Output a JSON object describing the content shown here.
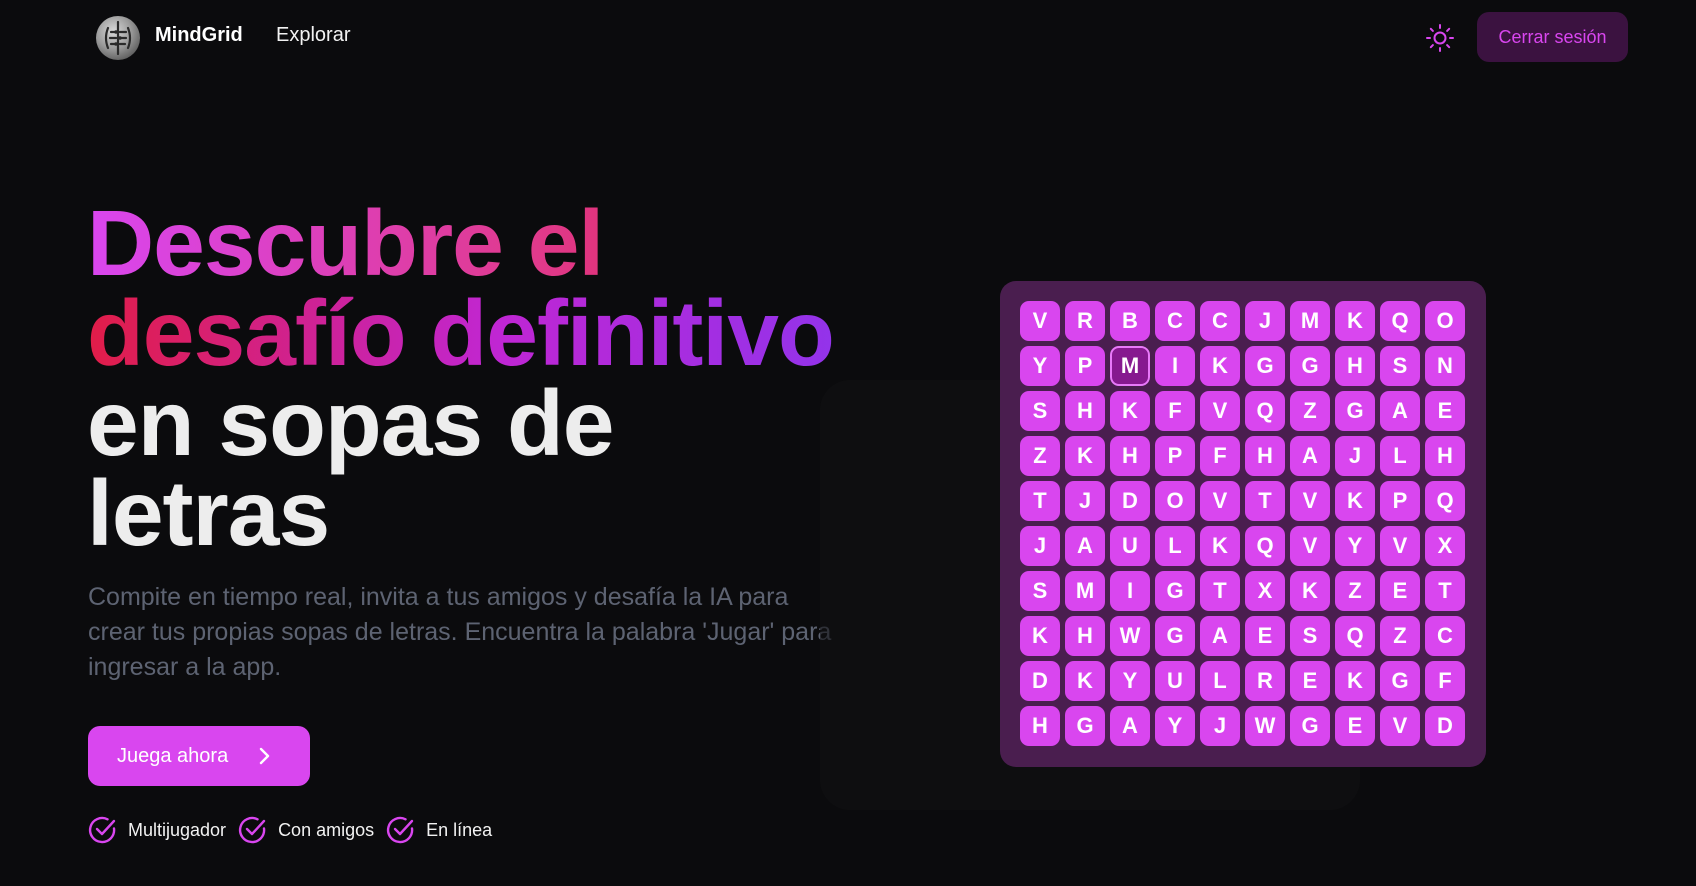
{
  "header": {
    "brand": "MindGrid",
    "nav_explore": "Explorar",
    "logout_label": "Cerrar sesión",
    "theme_icon": "sun-icon",
    "logo_icon": "brain-icon"
  },
  "hero": {
    "title_line1": "Descubre el",
    "title_line2": "desafío definitivo",
    "title_line3": "en sopas de",
    "title_line4": "letras",
    "description": "Compite en tiempo real, invita a tus amigos y desafía la IA para crear tus propias sopas de letras. Encuentra la palabra 'Jugar' para ingresar a la app.",
    "cta_label": "Juega ahora",
    "cta_icon": "chevron-right-icon",
    "features": [
      "Multijugador",
      "Con amigos",
      "En línea"
    ],
    "feature_icon": "check-circle-icon"
  },
  "puzzle": {
    "rows": [
      [
        "V",
        "R",
        "B",
        "C",
        "C",
        "J",
        "M",
        "K",
        "Q",
        "O"
      ],
      [
        "Y",
        "P",
        "M",
        "I",
        "K",
        "G",
        "G",
        "H",
        "S",
        "N"
      ],
      [
        "S",
        "H",
        "K",
        "F",
        "V",
        "Q",
        "Z",
        "G",
        "A",
        "E"
      ],
      [
        "Z",
        "K",
        "H",
        "P",
        "F",
        "H",
        "A",
        "J",
        "L",
        "H"
      ],
      [
        "T",
        "J",
        "D",
        "O",
        "V",
        "T",
        "V",
        "K",
        "P",
        "Q"
      ],
      [
        "J",
        "A",
        "U",
        "L",
        "K",
        "Q",
        "V",
        "Y",
        "V",
        "X"
      ],
      [
        "S",
        "M",
        "I",
        "G",
        "T",
        "X",
        "K",
        "Z",
        "E",
        "T"
      ],
      [
        "K",
        "H",
        "W",
        "G",
        "A",
        "E",
        "S",
        "Q",
        "Z",
        "C"
      ],
      [
        "D",
        "K",
        "Y",
        "U",
        "L",
        "R",
        "E",
        "K",
        "G",
        "F"
      ],
      [
        "H",
        "G",
        "A",
        "Y",
        "J",
        "W",
        "G",
        "E",
        "V",
        "D"
      ]
    ],
    "selected": {
      "row": 1,
      "col": 2
    }
  },
  "colors": {
    "accent": "#d946ef",
    "board_bg": "#4a1e4f",
    "selected_cell": "#86198f",
    "gradient_pink": "#e11d48",
    "gradient_purple": "#9333ea",
    "page_bg": "#0b0b0d"
  }
}
